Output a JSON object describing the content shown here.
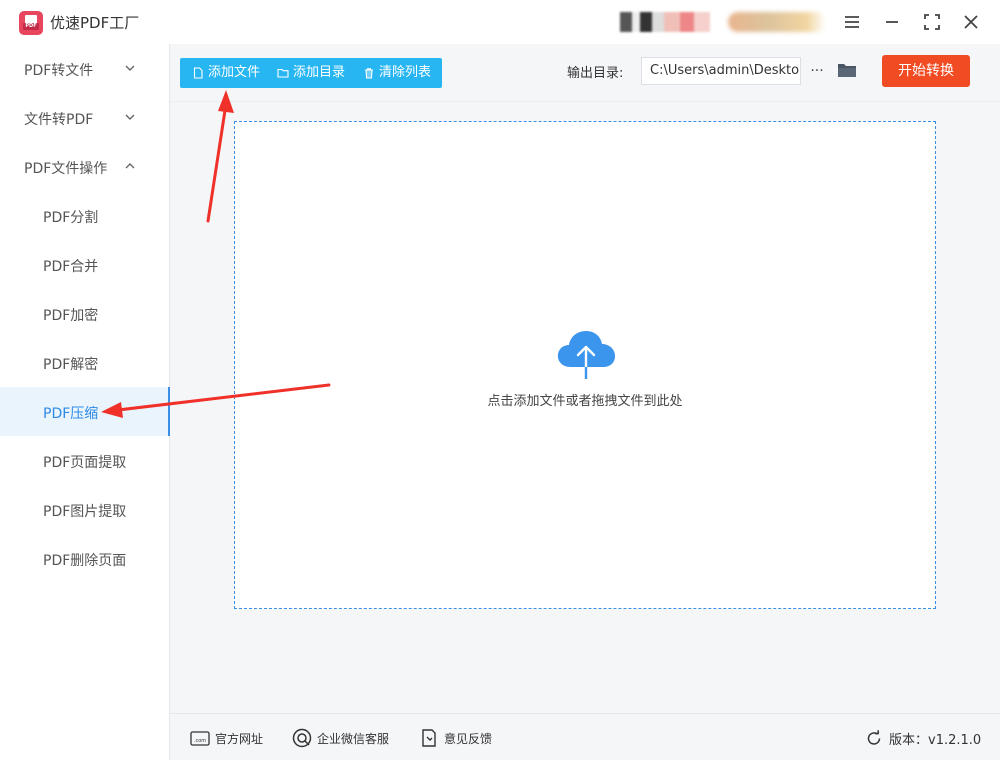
{
  "app": {
    "title": "优速PDF工厂",
    "logo_tag": "PDF"
  },
  "window_controls": {
    "menu_icon": "menu-icon",
    "minimize_icon": "minimize-icon",
    "maximize_icon": "maximize-icon",
    "close_icon": "close-icon"
  },
  "sidebar": {
    "items": [
      {
        "label": "PDF转文件",
        "type": "group",
        "expanded": false
      },
      {
        "label": "文件转PDF",
        "type": "group",
        "expanded": false
      },
      {
        "label": "PDF文件操作",
        "type": "group",
        "expanded": true
      },
      {
        "label": "PDF分割",
        "type": "sub"
      },
      {
        "label": "PDF合并",
        "type": "sub"
      },
      {
        "label": "PDF加密",
        "type": "sub"
      },
      {
        "label": "PDF解密",
        "type": "sub"
      },
      {
        "label": "PDF压缩",
        "type": "sub",
        "active": true
      },
      {
        "label": "PDF页面提取",
        "type": "sub"
      },
      {
        "label": "PDF图片提取",
        "type": "sub"
      },
      {
        "label": "PDF删除页面",
        "type": "sub"
      }
    ]
  },
  "toolbar": {
    "add_file": "添加文件",
    "add_folder": "添加目录",
    "clear_list": "清除列表",
    "output_label": "输出目录:",
    "output_path": "C:\\Users\\admin\\Desktop",
    "more": "···",
    "start": "开始转换"
  },
  "dropzone": {
    "hint": "点击添加文件或者拖拽文件到此处",
    "icon": "cloud-upload-icon"
  },
  "footer": {
    "website": "官方网址",
    "wechat": "企业微信客服",
    "feedback": "意见反馈",
    "version": "版本：v1.2.1.0"
  },
  "colors": {
    "accent": "#27b6f2",
    "start": "#f04b22",
    "active_text": "#2d8ae6",
    "annotation_arrow": "#f0312a"
  }
}
